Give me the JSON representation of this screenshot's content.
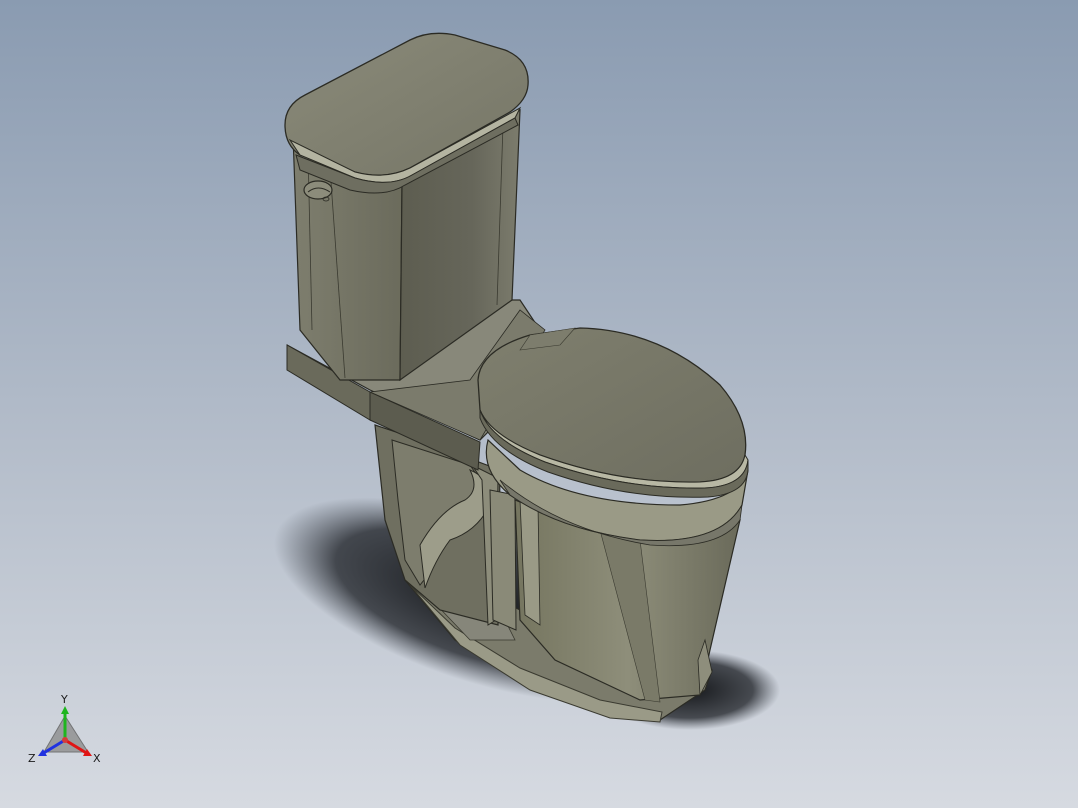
{
  "viewport": {
    "background_top": "#8a9bb1",
    "background_bottom": "#d6dae1"
  },
  "model": {
    "body_color": "#8c8c7b",
    "shadow_color": "#0d0f12"
  },
  "triad": {
    "x_label": "X",
    "y_label": "Y",
    "z_label": "Z",
    "x_color": "#e01515",
    "y_color": "#1fb51f",
    "z_color": "#2032e0"
  }
}
